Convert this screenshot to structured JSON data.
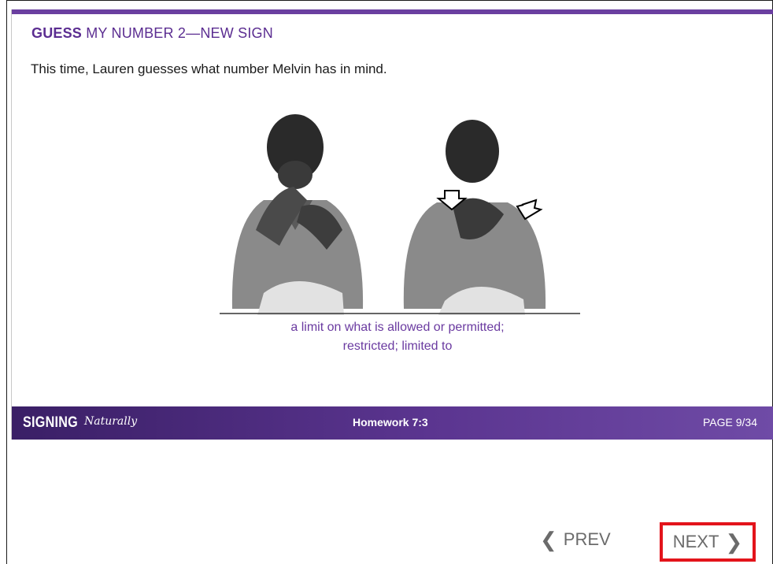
{
  "slide": {
    "title_bold": "GUESS",
    "title_rest": " MY NUMBER 2—NEW SIGN",
    "instructions": "This time, Lauren guesses what number Melvin has in mind.",
    "caption_line1": "a limit on what is allowed or permitted;",
    "caption_line2": "restricted; limited to"
  },
  "footer": {
    "brand_main": "SIGNING",
    "brand_script": "Naturally",
    "lesson": "Homework 7:3",
    "page": "PAGE 9/34"
  },
  "nav": {
    "prev_label": "PREV",
    "next_label": "NEXT"
  },
  "colors": {
    "accent": "#5b2d91",
    "footer_start": "#3a1f66",
    "footer_end": "#6f4ba6",
    "highlight": "#e3141b"
  }
}
